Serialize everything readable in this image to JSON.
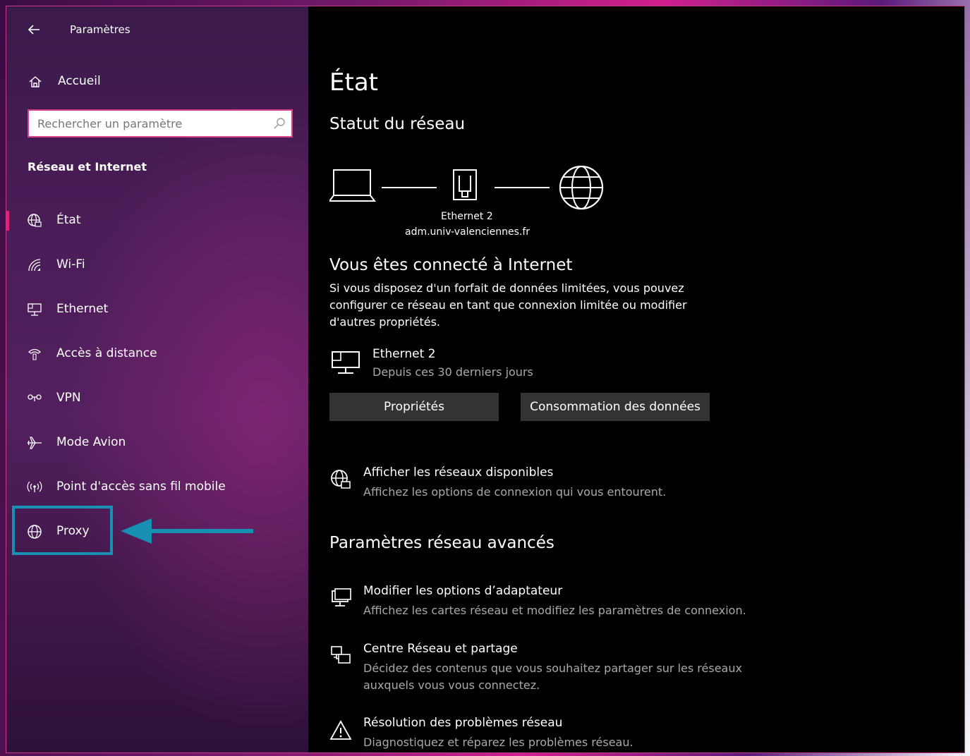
{
  "window": {
    "app_title": "Paramètres",
    "caption": {
      "minimize": "—",
      "maximize": "☐",
      "close": "✕"
    }
  },
  "sidebar": {
    "home_label": "Accueil",
    "search_placeholder": "Rechercher un paramètre",
    "section_heading": "Réseau et Internet",
    "items": [
      {
        "label": "État",
        "icon": "globe-status-icon",
        "active": true
      },
      {
        "label": "Wi-Fi",
        "icon": "wifi-icon"
      },
      {
        "label": "Ethernet",
        "icon": "ethernet-icon"
      },
      {
        "label": "Accès à distance",
        "icon": "dialup-icon"
      },
      {
        "label": "VPN",
        "icon": "vpn-icon"
      },
      {
        "label": "Mode Avion",
        "icon": "airplane-icon"
      },
      {
        "label": "Point d'accès sans fil mobile",
        "icon": "hotspot-icon"
      },
      {
        "label": "Proxy",
        "icon": "globe-icon",
        "highlighted": true
      }
    ],
    "highlight_color": "#1790b3",
    "accent_color": "#e0246f"
  },
  "main": {
    "title": "État",
    "network_status_heading": "Statut du réseau",
    "diagram": {
      "adapter_name": "Ethernet 2",
      "domain": "adm.univ-valenciennes.fr"
    },
    "connected_heading": "Vous êtes connecté à Internet",
    "connected_desc": [
      "Si vous disposez d'un forfait de données limitées, vous pouvez",
      "configurer ce réseau en tant que connexion limitée ou modifier",
      "d'autres propriétés."
    ],
    "adapter": {
      "name": "Ethernet 2",
      "period": "Depuis ces 30 derniers jours"
    },
    "buttons": {
      "properties": "Propriétés",
      "data_usage": "Consommation des données"
    },
    "show_networks": {
      "title": "Afficher les réseaux disponibles",
      "desc": "Affichez les options de connexion qui vous entourent."
    },
    "advanced_heading": "Paramètres réseau avancés",
    "advanced_links": [
      {
        "title": "Modifier les options d’adaptateur",
        "desc": [
          "Affichez les cartes réseau et modifiez les paramètres de connexion."
        ]
      },
      {
        "title": "Centre Réseau et partage",
        "desc": [
          "Décidez des contenus que vous souhaitez partager sur les réseaux",
          "auxquels vous vous connectez."
        ]
      },
      {
        "title": "Résolution des problèmes réseau",
        "desc": [
          "Diagnostiquez et réparez les problèmes réseau."
        ]
      }
    ]
  }
}
